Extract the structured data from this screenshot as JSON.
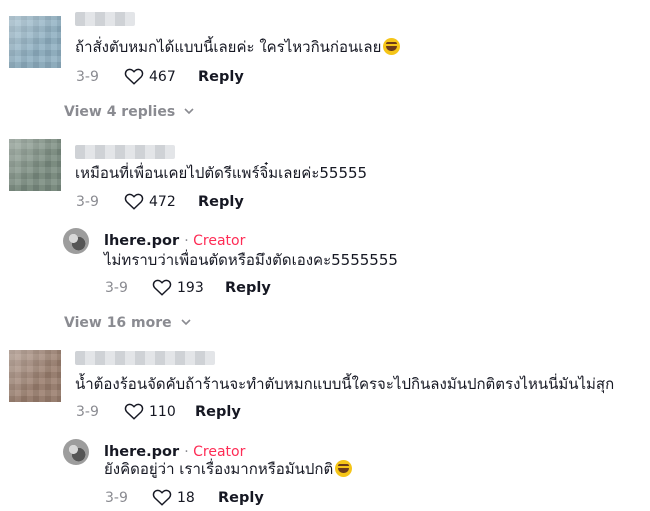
{
  "comments": [
    {
      "text": "ถ้าสั่งตับหมกได้แบบนี้เลยค่ะ ใครไหวกินก่อนเลย",
      "emoji": "grinning-squint-emoji",
      "date": "3-9",
      "likes": "467",
      "reply_label": "Reply",
      "view_replies": "View 4 replies"
    },
    {
      "text": "เหมือนที่เพื่อนเคยไปตัดรีแพร์จิ๋มเลยค่ะ55555",
      "date": "3-9",
      "likes": "472",
      "reply_label": "Reply",
      "reply": {
        "author": "lhere.por",
        "badge": "Creator",
        "text": "ไม่ทราบว่าเพื่อนตัดหรือมึงตัดเองคะ5555555",
        "date": "3-9",
        "likes": "193",
        "reply_label": "Reply"
      },
      "view_more": "View 16 more"
    },
    {
      "text": "น้ำต้องร้อนจัดคับถ้าร้านจะทำตับหมกแบบนี้ใครจะไปกินลงมันปกติตรงไหนนี่มันไม่สุก",
      "date": "3-9",
      "likes": "110",
      "reply_label": "Reply",
      "reply": {
        "author": "lhere.por",
        "badge": "Creator",
        "text": "ยังคิดอยู่ว่า เราเรื่องมากหรือมันปกติ",
        "emoji": "sweat-smile-emoji",
        "date": "3-9",
        "likes": "18",
        "reply_label": "Reply"
      }
    }
  ],
  "colors": {
    "creator": "#fe2c55",
    "muted": "#8a8b91",
    "text": "#161823"
  }
}
